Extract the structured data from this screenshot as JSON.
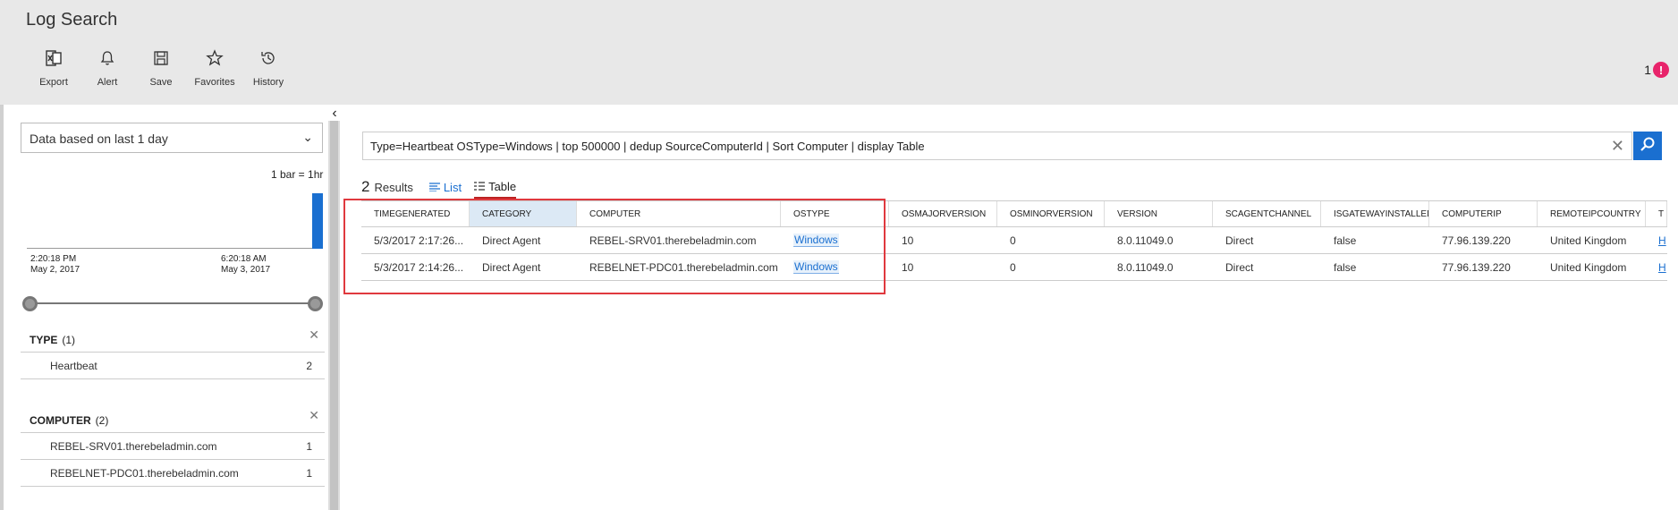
{
  "app": {
    "title": "Log Search"
  },
  "toolbar": {
    "items": [
      {
        "label": "Export",
        "icon": "excel-icon"
      },
      {
        "label": "Alert",
        "icon": "bell-icon"
      },
      {
        "label": "Save",
        "icon": "save-icon"
      },
      {
        "label": "Favorites",
        "icon": "star-icon"
      },
      {
        "label": "History",
        "icon": "history-icon"
      }
    ]
  },
  "notifications": {
    "count": "1",
    "badge": "!",
    "color": "#e8246b"
  },
  "left_panel": {
    "time_range": "Data based on last 1 day",
    "bar_legend": "1 bar = 1hr",
    "histogram": {
      "values": [
        0,
        0,
        0,
        0,
        0,
        0,
        0,
        0,
        0,
        0,
        0,
        0,
        0,
        0,
        0,
        0,
        0,
        0,
        0,
        0,
        0,
        0,
        0,
        2
      ],
      "max": 2
    },
    "timeline": [
      {
        "time": "2:20:18 PM",
        "date": "May 2, 2017"
      },
      {
        "time": "6:20:18 AM",
        "date": "May 3, 2017"
      }
    ],
    "facets": [
      {
        "title": "TYPE",
        "count": "(1)",
        "rows": [
          {
            "label": "Heartbeat",
            "value": "2"
          }
        ]
      },
      {
        "title": "COMPUTER",
        "count": "(2)",
        "rows": [
          {
            "label": "REBEL-SRV01.therebeladmin.com",
            "value": "1"
          },
          {
            "label": "REBELNET-PDC01.therebeladmin.com",
            "value": "1"
          }
        ]
      }
    ]
  },
  "search": {
    "query": "Type=Heartbeat OSType=Windows | top 500000 | dedup SourceComputerId | Sort Computer | display Table",
    "clear": "✕"
  },
  "results": {
    "count": "2",
    "label": "Results",
    "tabs": [
      {
        "label": "List"
      },
      {
        "label": "Table"
      }
    ]
  },
  "table": {
    "columns": [
      "TIMEGENERATED",
      "CATEGORY",
      "COMPUTER",
      "OSTYPE",
      "OSMAJORVERSION",
      "OSMINORVERSION",
      "VERSION",
      "SCAGENTCHANNEL",
      "ISGATEWAYINSTALLED",
      "COMPUTERIP",
      "REMOTEIPCOUNTRY",
      "T"
    ],
    "rows": [
      [
        "5/3/2017 2:17:26...",
        "Direct Agent",
        "REBEL-SRV01.therebeladmin.com",
        "Windows",
        "10",
        "0",
        "8.0.11049.0",
        "Direct",
        "false",
        "77.96.139.220",
        "United Kingdom",
        "H"
      ],
      [
        "5/3/2017 2:14:26...",
        "Direct Agent",
        "REBELNET-PDC01.therebeladmin.com",
        "Windows",
        "10",
        "0",
        "8.0.11049.0",
        "Direct",
        "false",
        "77.96.139.220",
        "United Kingdom",
        "H"
      ]
    ]
  },
  "colors": {
    "accent": "#1a6fd0",
    "highlight_box": "#e0393e",
    "header_bg": "#e8e8e8"
  }
}
